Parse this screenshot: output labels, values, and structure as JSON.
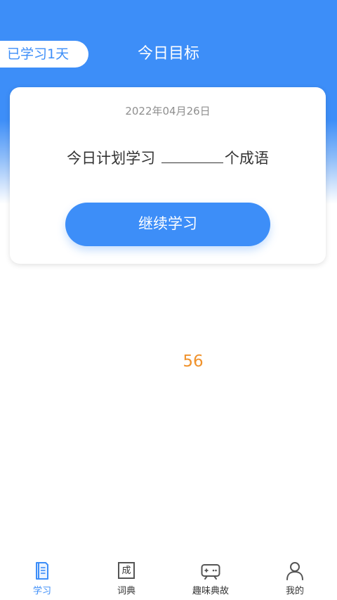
{
  "header": {
    "studied_days": "已学习1天",
    "title": "今日目标"
  },
  "goal_card": {
    "date": "2022年04月26日",
    "plan_prefix": "今日计划学习",
    "plan_suffix": "个成语",
    "continue_label": "继续学习"
  },
  "counter": "56",
  "tabbar": {
    "tabs": [
      {
        "label": "学习",
        "icon": "book-icon",
        "active": true
      },
      {
        "label": "词典",
        "icon": "dictionary-icon",
        "glyph": "成",
        "active": false
      },
      {
        "label": "趣味典故",
        "icon": "gamepad-icon",
        "active": false
      },
      {
        "label": "我的",
        "icon": "user-icon",
        "active": false
      }
    ]
  },
  "colors": {
    "primary": "#3d8ef8",
    "counter": "#f0922c",
    "text": "#333333",
    "muted": "#8f8f8f"
  }
}
